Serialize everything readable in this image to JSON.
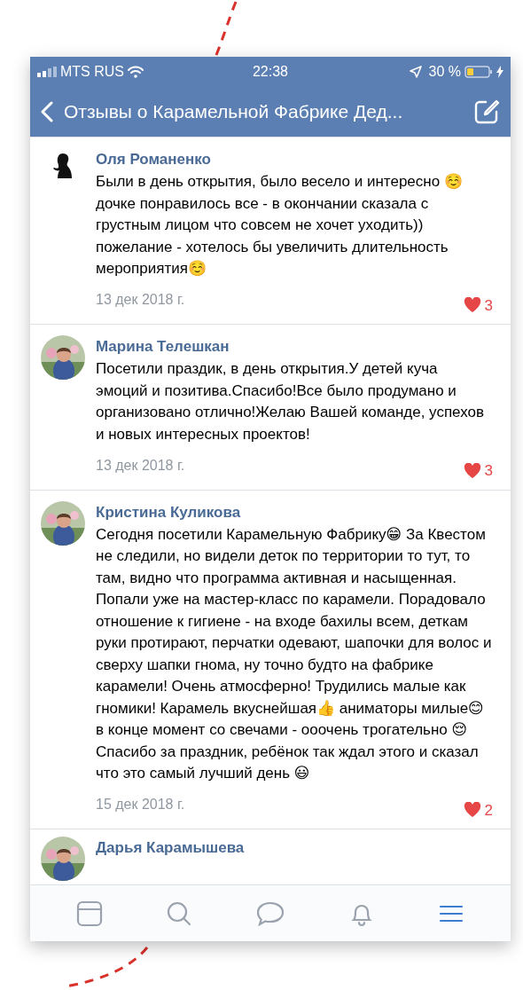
{
  "status_bar": {
    "carrier": "MTS RUS",
    "time": "22:38",
    "battery": "30 %"
  },
  "header": {
    "title": "Отзывы о Карамельной Фабрике Дед..."
  },
  "reviews": [
    {
      "author": "Оля Романенко",
      "avatar": {
        "kind": "silhouette"
      },
      "text": "Были в день открытия, было весело и интересно ☺️дочке понравилось все - в окончании сказала с грустным лицом что совсем не хочет уходить)) пожелание - хотелось бы увеличить длительность мероприятия☺️",
      "date": "13 дек 2018 г.",
      "likes": "3"
    },
    {
      "author": "Марина Телешкан",
      "text": "Посетили праздик, в день открытия.У детей куча эмоций и позитива.Спасибо!Все было продумано и организовано отлично!Желаю Вашей команде, успехов и новых интересных проектов!",
      "date": "13 дек 2018 г.",
      "likes": "3"
    },
    {
      "author": "Кристина Куликова",
      "text": "Сегодня посетили Карамельную Фабрику😁 За Квестом не следили, но видели деток по территории то тут, то там, видно что программа активная и насыщенная. Попали уже на мастер-класс по карамели. Порадовало отношение к гигиене - на входе бахилы всем, деткам руки протирают, перчатки одевают, шапочки для волос и сверху шапки гнома, ну точно будто на фабрике карамели! Очень атмосферно! Трудились малые как гномики! Карамель вкуснейшая👍 аниматоры милые😊 в конце момент со свечами - ооочень трогательно 😌 Спасибо за праздник, ребёнок так ждал этого и сказал что это самый лучший день 😃",
      "date": "15 дек 2018 г.",
      "likes": "2"
    },
    {
      "author": "Дарья Карамышева"
    }
  ],
  "tab_bar": [
    {
      "kind": "feed",
      "selected": false
    },
    {
      "kind": "search",
      "selected": false
    },
    {
      "kind": "messages",
      "selected": false
    },
    {
      "kind": "notifications",
      "selected": false
    },
    {
      "kind": "menu",
      "selected": true
    }
  ]
}
